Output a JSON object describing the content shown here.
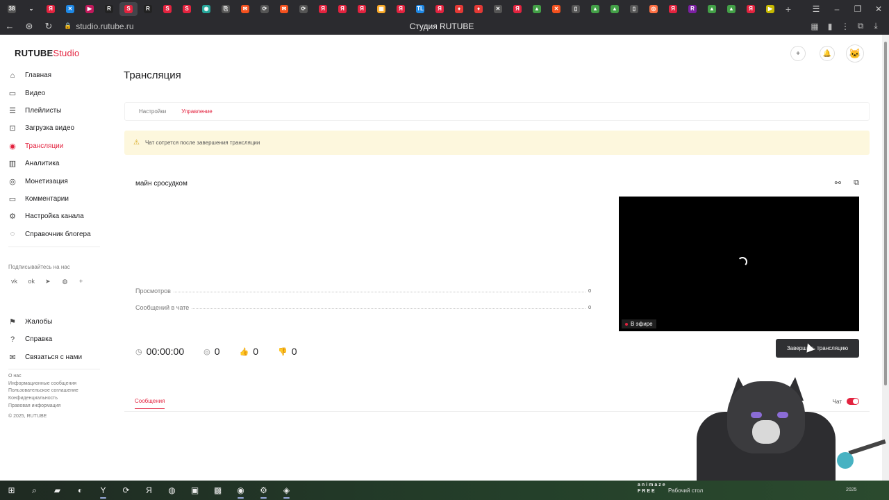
{
  "browser": {
    "tabs": [
      {
        "glyph": "38",
        "color": "#555555"
      },
      {
        "glyph": "⌄",
        "color": "#2b2b2f"
      },
      {
        "glyph": "Я",
        "color": "#e3233f"
      },
      {
        "glyph": "✕",
        "color": "#1e88e5"
      },
      {
        "glyph": "▶",
        "color": "#c2185b"
      },
      {
        "glyph": "R",
        "color": "#222222"
      },
      {
        "glyph": "S",
        "color": "#e3233f"
      },
      {
        "glyph": "R",
        "color": "#222222"
      },
      {
        "glyph": "S",
        "color": "#e3233f"
      },
      {
        "glyph": "S",
        "color": "#e3233f"
      },
      {
        "glyph": "◉",
        "color": "#26a69a"
      },
      {
        "glyph": "⎘",
        "color": "#555555"
      },
      {
        "glyph": "✉",
        "color": "#f4511e"
      },
      {
        "glyph": "⟳",
        "color": "#555555"
      },
      {
        "glyph": "✉",
        "color": "#f4511e"
      },
      {
        "glyph": "⟳",
        "color": "#555555"
      },
      {
        "glyph": "Я",
        "color": "#e3233f"
      },
      {
        "glyph": "Я",
        "color": "#e3233f"
      },
      {
        "glyph": "Я",
        "color": "#e3233f"
      },
      {
        "glyph": "▦",
        "color": "#f9a825"
      },
      {
        "glyph": "Я",
        "color": "#e3233f"
      },
      {
        "glyph": "TL",
        "color": "#1e88e5"
      },
      {
        "glyph": "Я",
        "color": "#e3233f"
      },
      {
        "glyph": "♦",
        "color": "#e53935"
      },
      {
        "glyph": "♦",
        "color": "#e53935"
      },
      {
        "glyph": "✕",
        "color": "#555555"
      },
      {
        "glyph": "Я",
        "color": "#e3233f"
      },
      {
        "glyph": "▲",
        "color": "#43a047"
      },
      {
        "glyph": "✕",
        "color": "#f4511e"
      },
      {
        "glyph": "▯",
        "color": "#555555"
      },
      {
        "glyph": "▲",
        "color": "#43a047"
      },
      {
        "glyph": "▲",
        "color": "#43a047"
      },
      {
        "glyph": "▯",
        "color": "#555555"
      },
      {
        "glyph": "◎",
        "color": "#ff7043"
      },
      {
        "glyph": "Я",
        "color": "#e3233f"
      },
      {
        "glyph": "R",
        "color": "#7b1fa2"
      },
      {
        "glyph": "▲",
        "color": "#43a047"
      },
      {
        "glyph": "▲",
        "color": "#43a047"
      },
      {
        "glyph": "Я",
        "color": "#e3233f"
      },
      {
        "glyph": "▶",
        "color": "#c6b800"
      }
    ],
    "active_tab_index": 6,
    "url": "studio.rutube.ru",
    "page_title": "Студия RUTUBE"
  },
  "brand": {
    "name": "RUTUBE",
    "suffix": "Studio",
    "accent": "#e3233f"
  },
  "sidebar": {
    "items": [
      {
        "label": "Главная",
        "icon": "home-icon",
        "glyph": "⌂"
      },
      {
        "label": "Видео",
        "icon": "video-icon",
        "glyph": "▭"
      },
      {
        "label": "Плейлисты",
        "icon": "playlist-icon",
        "glyph": "☰"
      },
      {
        "label": "Загрузка видео",
        "icon": "upload-icon",
        "glyph": "⊡"
      },
      {
        "label": "Трансляции",
        "icon": "broadcast-icon",
        "glyph": "◉"
      },
      {
        "label": "Аналитика",
        "icon": "analytics-icon",
        "glyph": "▥"
      },
      {
        "label": "Монетизация",
        "icon": "monetization-icon",
        "glyph": "◎"
      },
      {
        "label": "Комментарии",
        "icon": "comments-icon",
        "glyph": "▭"
      },
      {
        "label": "Настройка канала",
        "icon": "gear-icon",
        "glyph": "⚙"
      },
      {
        "label": "Справочник блогера",
        "icon": "handbook-icon",
        "glyph": "◌"
      }
    ],
    "active_index": 4,
    "subscribe_label": "Подписывайтесь на нас",
    "socials": [
      {
        "glyph": "vk",
        "icon": "vk-icon"
      },
      {
        "glyph": "ok",
        "icon": "ok-icon"
      },
      {
        "glyph": "➤",
        "icon": "telegram-icon"
      },
      {
        "glyph": "◍",
        "icon": "viber-icon"
      },
      {
        "glyph": "+",
        "icon": "more-icon"
      }
    ],
    "secondary": [
      {
        "label": "Жалобы",
        "icon": "flag-icon",
        "glyph": "⚑"
      },
      {
        "label": "Справка",
        "icon": "help-icon",
        "glyph": "?"
      },
      {
        "label": "Связаться с нами",
        "icon": "mail-icon",
        "glyph": "✉"
      }
    ],
    "footer_links": [
      "О нас",
      "Информационные сообщения",
      "Пользовательское соглашение",
      "Конфиденциальность",
      "Правовая информация"
    ],
    "copyright": "© 2025, RUTUBE"
  },
  "header": {
    "icons": [
      {
        "name": "add-icon",
        "glyph": "+"
      },
      {
        "name": "bell-icon",
        "glyph": "●"
      }
    ],
    "avatar": "🐱"
  },
  "main": {
    "title": "Трансляция",
    "tabs": [
      "Настройки",
      "Управление"
    ],
    "active_tab": 1,
    "notice": "Чат сотрется после завершения трансляции",
    "stream": {
      "name": "майн сросудком",
      "stats": [
        {
          "label": "Просмотров",
          "value": "0"
        },
        {
          "label": "Сообщений в чате",
          "value": "0"
        }
      ],
      "live_label": "В эфире",
      "duration": "00:00:00",
      "viewers": "0",
      "likes": "0",
      "dislikes": "0",
      "end_button": "Завершить трансляцию"
    },
    "chat": {
      "tab": "Сообщения",
      "toggle_label": "Чат",
      "enabled": true
    }
  },
  "taskbar": {
    "icons": [
      {
        "name": "windows-start-icon",
        "glyph": "⊞",
        "open": false
      },
      {
        "name": "search-icon",
        "glyph": "⌕",
        "open": false
      },
      {
        "name": "file-explorer-icon",
        "glyph": "▰",
        "open": false
      },
      {
        "name": "edge-icon",
        "glyph": "◐",
        "open": false
      },
      {
        "name": "yandex-browser-icon",
        "glyph": "Y",
        "open": true
      },
      {
        "name": "app-icon",
        "glyph": "⟳",
        "open": false
      },
      {
        "name": "yandex-icon",
        "glyph": "Я",
        "open": false
      },
      {
        "name": "discord-icon",
        "glyph": "◍",
        "open": false
      },
      {
        "name": "minecraft-icon",
        "glyph": "▣",
        "open": false
      },
      {
        "name": "minecraft-launcher-icon",
        "glyph": "▩",
        "open": false
      },
      {
        "name": "obs-icon",
        "glyph": "◉",
        "open": true
      },
      {
        "name": "app2-icon",
        "glyph": "⚙",
        "open": true
      },
      {
        "name": "app3-icon",
        "glyph": "◈",
        "open": true
      }
    ],
    "brand_line1": "animaze",
    "brand_line2": "FREE",
    "desktop_label": "Рабочий стол",
    "clock_fragment": "2025"
  }
}
